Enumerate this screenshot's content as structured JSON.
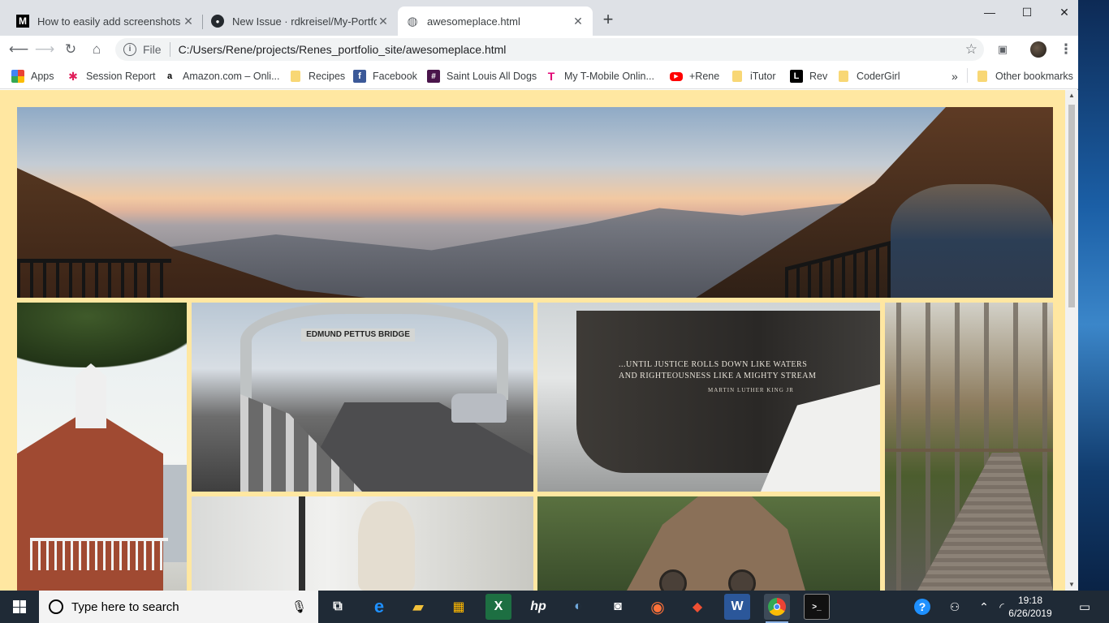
{
  "browser": {
    "tabs": [
      {
        "title": "How to easily add screenshots in",
        "favicon": "M",
        "favicon_name": "medium-logo"
      },
      {
        "title": "New Issue · rdkreisel/My-Portfolio",
        "favicon": "●",
        "favicon_name": "github-logo"
      },
      {
        "title": "awesomeplace.html",
        "favicon": "◍",
        "favicon_name": "globe-icon"
      }
    ],
    "window_controls": {
      "minimize": "—",
      "maximize": "☐",
      "close": "✕"
    },
    "new_tab_symbol": "+",
    "address": {
      "scheme_label": "File",
      "url": "C:/Users/Rene/projects/Renes_portfolio_site/awesomeplace.html"
    },
    "bookmarks": [
      {
        "label": "Apps",
        "icon": "apps-grid-icon",
        "color": "#4285f4"
      },
      {
        "label": "Session Report",
        "icon": "slack-icon",
        "color": "#e01e5a"
      },
      {
        "label": "Amazon.com – Onli...",
        "icon": "amazon-icon",
        "color": "#000000"
      },
      {
        "label": "Recipes",
        "icon": "folder-icon",
        "color": "#f8d775"
      },
      {
        "label": "Facebook",
        "icon": "facebook-icon",
        "color": "#3b5998"
      },
      {
        "label": "Saint Louis All Dogs",
        "icon": "slack-icon",
        "color": "#4a154b"
      },
      {
        "label": "My T-Mobile Onlin...",
        "icon": "tmobile-icon",
        "color": "#e20074"
      },
      {
        "label": "+Rene",
        "icon": "youtube-icon",
        "color": "#ff0000"
      },
      {
        "label": "iTutor",
        "icon": "folder-icon",
        "color": "#f8d775"
      },
      {
        "label": "Rev",
        "icon": "rev-icon",
        "color": "#000000"
      },
      {
        "label": "CoderGirl",
        "icon": "folder-icon",
        "color": "#f8d775"
      }
    ],
    "overflow_symbol": "»",
    "other_bookmarks": "Other bookmarks"
  },
  "page": {
    "background": "#ffe7a1",
    "memorial_quote_line1": "...UNTIL JUSTICE ROLLS DOWN LIKE WATERS",
    "memorial_quote_line2": "AND RIGHTEOUSNESS LIKE A MIGHTY STREAM",
    "memorial_author": "MARTIN LUTHER KING JR",
    "bridge_sign": "EDMUND PETTUS BRIDGE"
  },
  "taskbar": {
    "search_placeholder": "Type here to search",
    "time": "19:18",
    "date": "6/26/2019",
    "apps": [
      "task-view-icon",
      "edge-icon",
      "file-explorer-icon",
      "store-icon",
      "excel-icon",
      "hp-icon",
      "app-icon",
      "camera-icon",
      "firefox-icon",
      "git-icon",
      "word-icon",
      "chrome-icon",
      "terminal-icon"
    ]
  }
}
